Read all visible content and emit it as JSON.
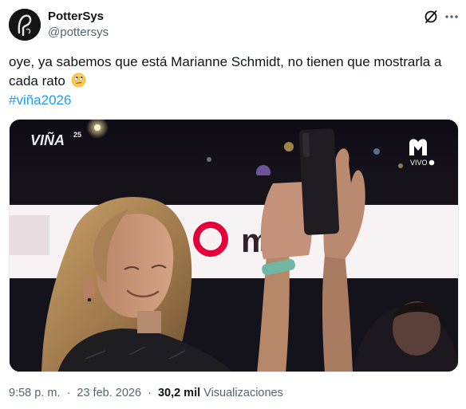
{
  "author": {
    "display_name": "PotterSys",
    "handle": "@pottersys"
  },
  "tweet": {
    "text": "oye, ya sabemos que está Marianne Schmidt, no tienen que mostrarla a cada rato",
    "emoji": "face-with-rolling-eyes",
    "hashtag": "#viña2026"
  },
  "media": {
    "overlay_logo": "VIÑA",
    "overlay_logo_superscript": "25",
    "live_label": "VIVO",
    "banner_text": "m",
    "kind": "video-still"
  },
  "meta": {
    "time": "9:58 p. m.",
    "date": "23 feb. 2026",
    "views_count": "30,2 mil",
    "views_label": "Visualizaciones"
  },
  "colors": {
    "text": "#0f1419",
    "secondary": "#536471",
    "link": "#1d9bf0"
  }
}
